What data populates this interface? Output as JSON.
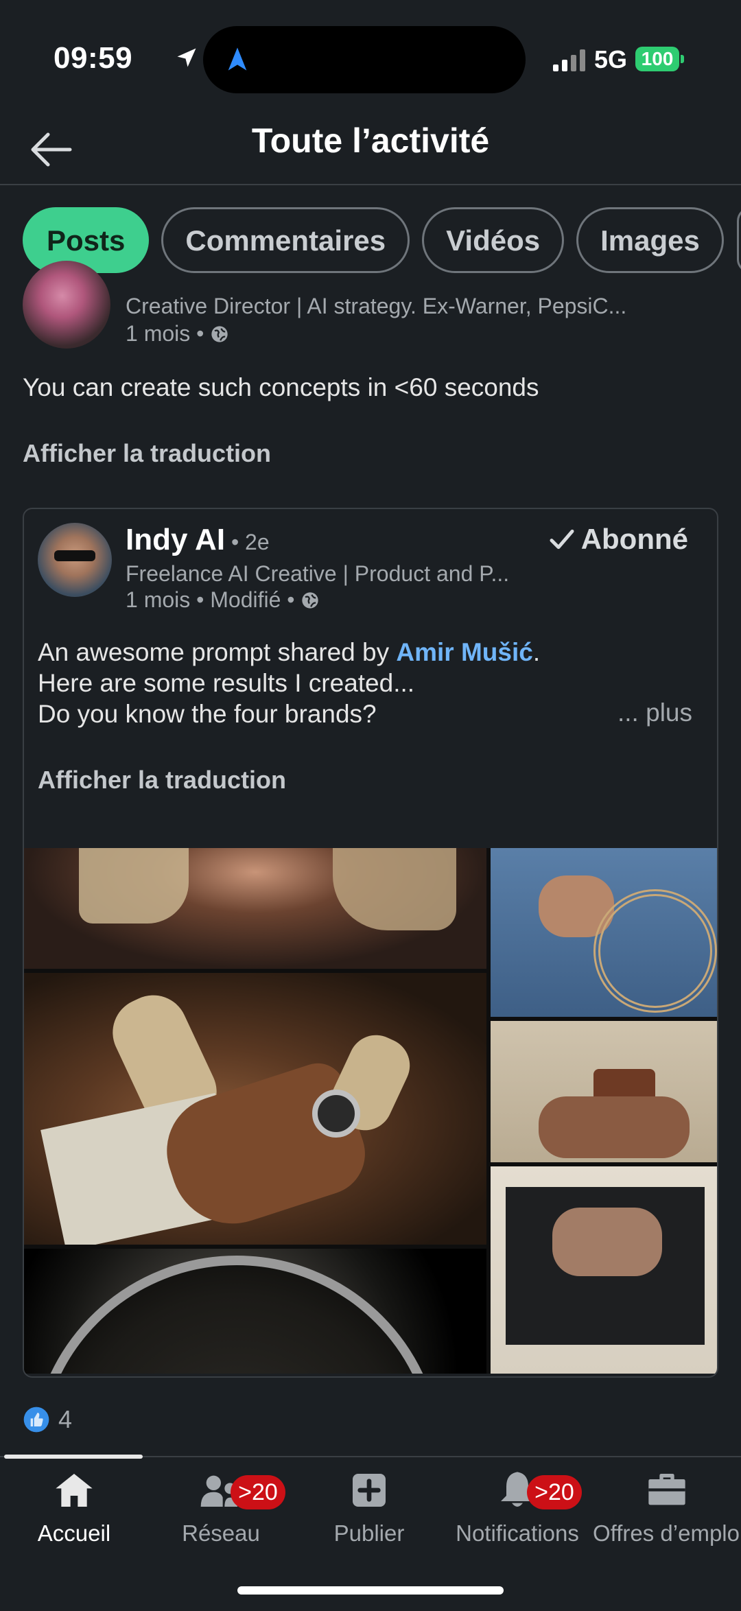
{
  "status_bar": {
    "time": "09:59",
    "network": "5G",
    "battery": "100"
  },
  "header": {
    "title": "Toute l’activité"
  },
  "filters": {
    "items": [
      "Posts",
      "Commentaires",
      "Vidéos",
      "Images"
    ],
    "active": "Posts"
  },
  "repost": {
    "headline": "Creative Director | AI strategy. Ex-Warner, PepsiC...",
    "time": "1 mois • ",
    "text": "You can create such concepts in <60 seconds",
    "translate": "Afficher la traduction"
  },
  "shared_post": {
    "author": "Indy AI",
    "degree": " • 2e",
    "follow": "Abonné",
    "headline": "Freelance AI Creative | Product and P...",
    "time": "1 mois • Modifié • ",
    "line1_prefix": "An awesome prompt shared by ",
    "mention": "Amir Mušić",
    "line1_suffix": ".",
    "line2": "Here are some results I created...",
    "line3": "Do you know the four brands?",
    "more": "... plus",
    "translate": "Afficher la traduction"
  },
  "reactions": {
    "count": "4"
  },
  "nav": {
    "items": [
      {
        "label": "Accueil",
        "icon": "home-icon"
      },
      {
        "label": "Réseau",
        "icon": "network-icon",
        "badge": ">20"
      },
      {
        "label": "Publier",
        "icon": "plus-icon"
      },
      {
        "label": "Notifications",
        "icon": "bell-icon",
        "badge": ">20"
      },
      {
        "label": "Offres d’emploi",
        "icon": "briefcase-icon"
      }
    ]
  },
  "colors": {
    "background": "#1b1f23",
    "accent": "#3ecf8e",
    "link": "#70b5f9",
    "badge": "#cc1016"
  }
}
